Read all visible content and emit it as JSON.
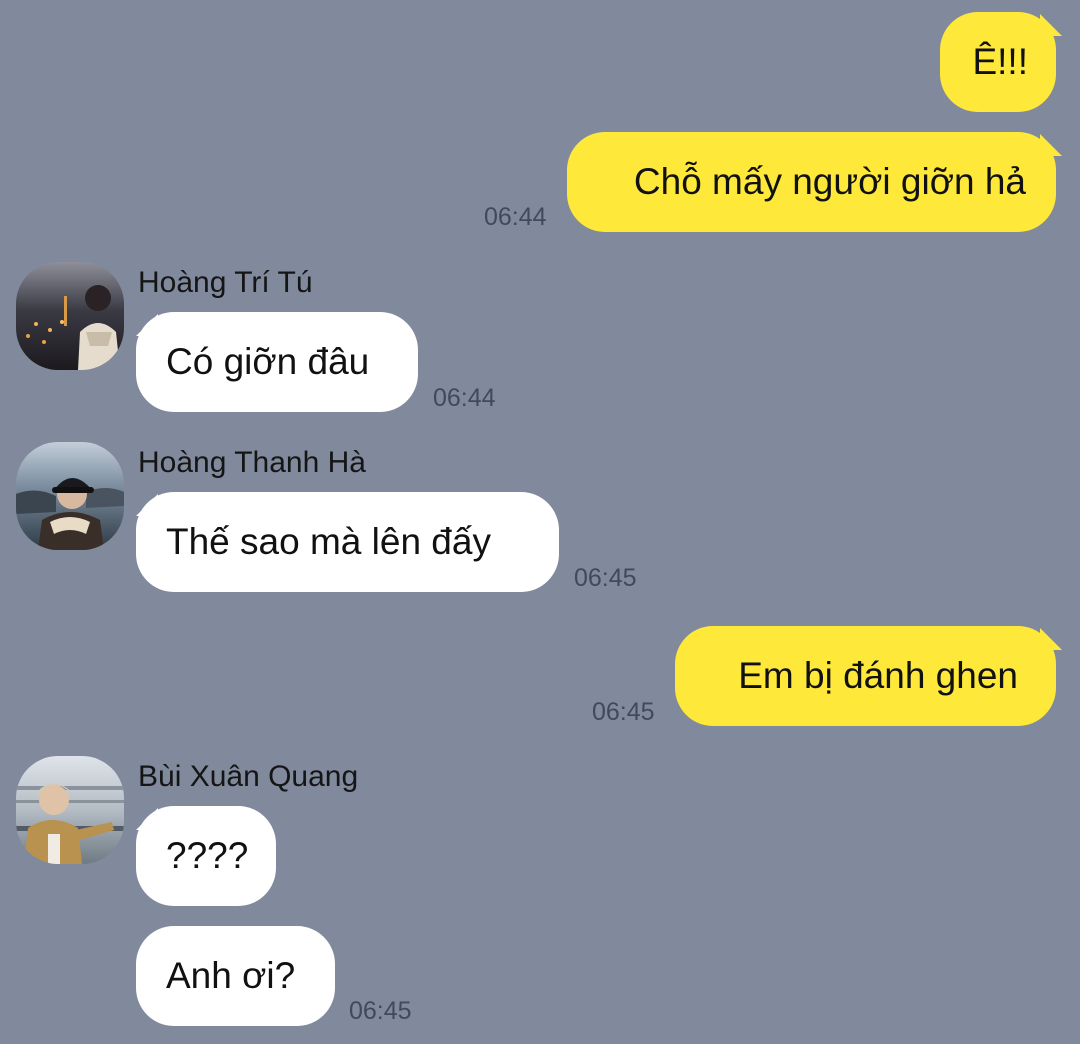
{
  "colors": {
    "background": "#808a9c",
    "outgoing_bubble": "#fee83a",
    "incoming_bubble": "#ffffff",
    "timestamp": "#414a5a"
  },
  "messages": [
    {
      "direction": "outgoing",
      "text": "Ê!!!"
    },
    {
      "direction": "outgoing",
      "text": "Chỗ mấy người giỡn hả",
      "time": "06:44"
    },
    {
      "direction": "incoming",
      "sender": "Hoàng Trí Tú",
      "text": "Có giỡn đâu",
      "time": "06:44",
      "avatar": "avatar-night-city"
    },
    {
      "direction": "incoming",
      "sender": "Hoàng Thanh Hà",
      "text": "Thế sao mà lên đấy",
      "time": "06:45",
      "avatar": "avatar-beach-cap"
    },
    {
      "direction": "outgoing",
      "text": "Em bị đánh ghen",
      "time": "06:45"
    },
    {
      "direction": "incoming",
      "sender": "Bùi Xuân Quang",
      "text": "????",
      "avatar": "avatar-railing"
    },
    {
      "direction": "incoming",
      "text": "Anh ơi?",
      "time": "06:45"
    }
  ]
}
